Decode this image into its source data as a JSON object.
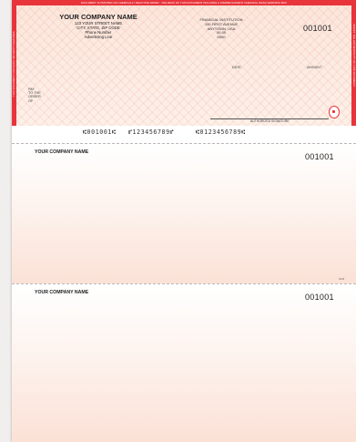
{
  "check": {
    "security_banner": "DOCUMENT IS PRINTED ON CHEMICALLY REACTIVE PAPER - THE BACK OF THIS DOCUMENT INCLUDES A TAMPER EVIDENT CHEMICAL WASH WARNING BOX",
    "left_sidebar_text": "THIS DOCUMENT CONTAINS SECURITY FEATURES",
    "right_sidebar_text": "VERIFY THE AUTHENTICITY OF THIS DOCUMENT",
    "company": {
      "name": "YOUR COMPANY NAME",
      "street": "123 YOUR STREET NAME",
      "city": "CITY, STATE, ZIP CODE",
      "phone": "Phone Number",
      "advertising": "Advertising Line"
    },
    "bank": {
      "name": "FINANCIAL INSTITUTION",
      "street": "100 FIRST AVENUE",
      "city": "ANYTOWN, USA",
      "fraction_top": "00-00",
      "fraction_bottom": "0000"
    },
    "check_number": "001001",
    "date_label": "DATE",
    "amount_label": "AMOUNT",
    "pay_label_line1": "PAY",
    "pay_label_line2": "TO THE",
    "pay_label_line3": "ORDER",
    "pay_label_line4": "OF",
    "signature_label": "AUTHORIZED SIGNATURE"
  },
  "micr": {
    "check_number": "⑆001001⑆",
    "routing": "⑈123456789⑈",
    "account": "⑆0123456789⑆"
  },
  "stub1": {
    "company_name": "YOUR COMPANY NAME",
    "check_number": "001001",
    "form_code": "9440"
  },
  "stub2": {
    "company_name": "YOUR COMPANY NAME",
    "check_number": "001001"
  },
  "colors": {
    "security_red": "#e8343b",
    "check_background": "#fdece3",
    "stub_gradient_end": "#fbe1d6"
  }
}
